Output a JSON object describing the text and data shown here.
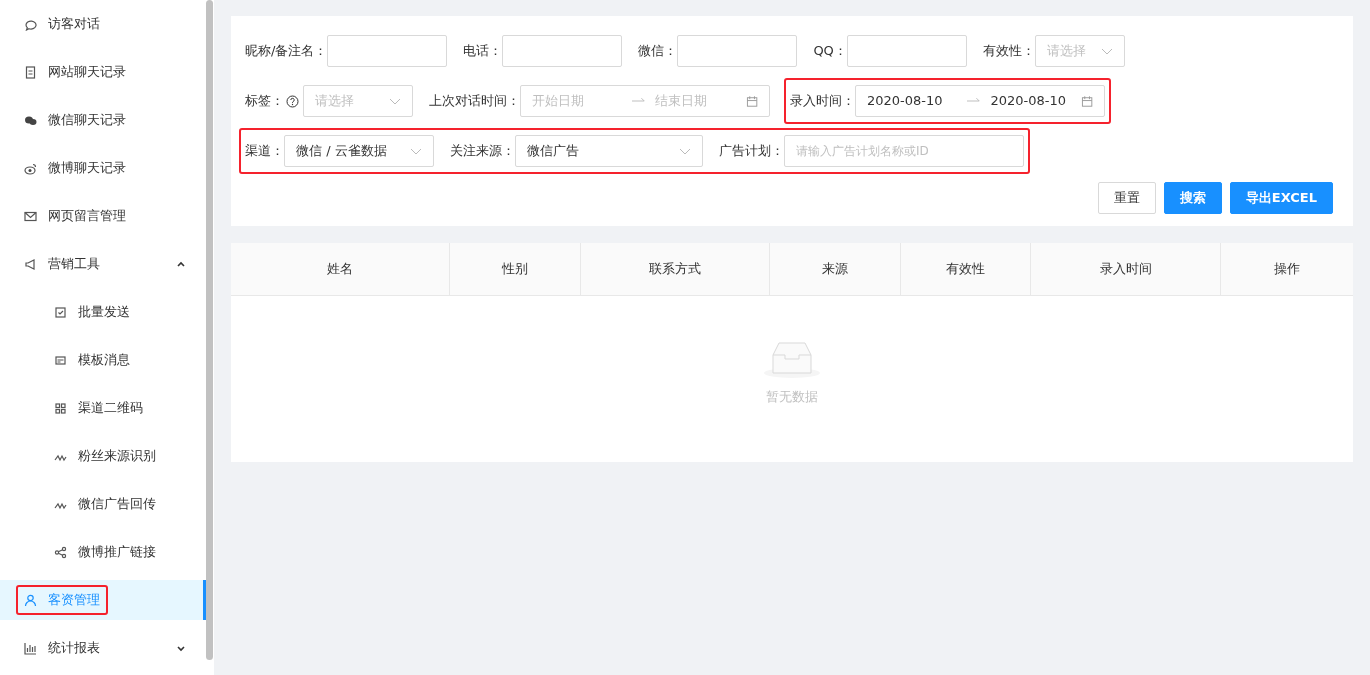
{
  "sidebar": {
    "items": [
      {
        "label": "访客对话",
        "selected": false,
        "highlighted": false
      },
      {
        "label": "网站聊天记录",
        "selected": false,
        "highlighted": false
      },
      {
        "label": "微信聊天记录",
        "selected": false,
        "highlighted": false
      },
      {
        "label": "微博聊天记录",
        "selected": false,
        "highlighted": false
      },
      {
        "label": "网页留言管理",
        "selected": false,
        "highlighted": false
      },
      {
        "label": "营销工具",
        "selected": false,
        "highlighted": false,
        "expanded": true,
        "children": [
          {
            "label": "批量发送",
            "selected": false
          },
          {
            "label": "模板消息",
            "selected": false
          },
          {
            "label": "渠道二维码",
            "selected": false
          },
          {
            "label": "粉丝来源识别",
            "selected": false
          },
          {
            "label": "微信广告回传",
            "selected": false
          },
          {
            "label": "微博推广链接",
            "selected": false
          }
        ]
      },
      {
        "label": "客资管理",
        "selected": true,
        "highlighted": true
      },
      {
        "label": "统计报表",
        "selected": false,
        "highlighted": false,
        "expanded": false
      }
    ]
  },
  "filters": {
    "rows": [
      {
        "groups": [
          {
            "highlighted": false,
            "fields": [
              {
                "kind": "text",
                "label": "昵称/备注名："
              },
              {
                "kind": "text",
                "label": "电话："
              },
              {
                "kind": "text",
                "label": "微信："
              },
              {
                "kind": "text",
                "label": "QQ："
              },
              {
                "kind": "select",
                "label": "有效性：",
                "placeholder": "请选择"
              }
            ]
          }
        ]
      },
      {
        "groups": [
          {
            "highlighted": false,
            "fields": [
              {
                "kind": "select",
                "label": "标签：",
                "help_icon": true,
                "placeholder": "请选择"
              },
              {
                "kind": "daterange",
                "label": "上次对话时间：",
                "start_placeholder": "开始日期",
                "end_placeholder": "结束日期"
              }
            ]
          },
          {
            "highlighted": true,
            "fields": [
              {
                "kind": "daterange",
                "label": "录入时间：",
                "start": "2020-08-10",
                "end": "2020-08-10"
              }
            ]
          }
        ]
      },
      {
        "groups": [
          {
            "highlighted": true,
            "fields": [
              {
                "kind": "select",
                "label": "渠道：",
                "value": "微信 / 云雀数据"
              },
              {
                "kind": "select",
                "label": "关注来源：",
                "value": "微信广告"
              },
              {
                "kind": "text",
                "label": "广告计划：",
                "placeholder": "请输入广告计划名称或ID"
              }
            ]
          }
        ]
      }
    ],
    "buttons": [
      {
        "label": "重置",
        "primary": false
      },
      {
        "label": "搜索",
        "primary": true
      },
      {
        "label": "导出EXCEL",
        "primary": true
      }
    ]
  },
  "table": {
    "columns": [
      "姓名",
      "性别",
      "联系方式",
      "来源",
      "有效性",
      "录入时间",
      "操作"
    ],
    "empty_text": "暂无数据"
  }
}
